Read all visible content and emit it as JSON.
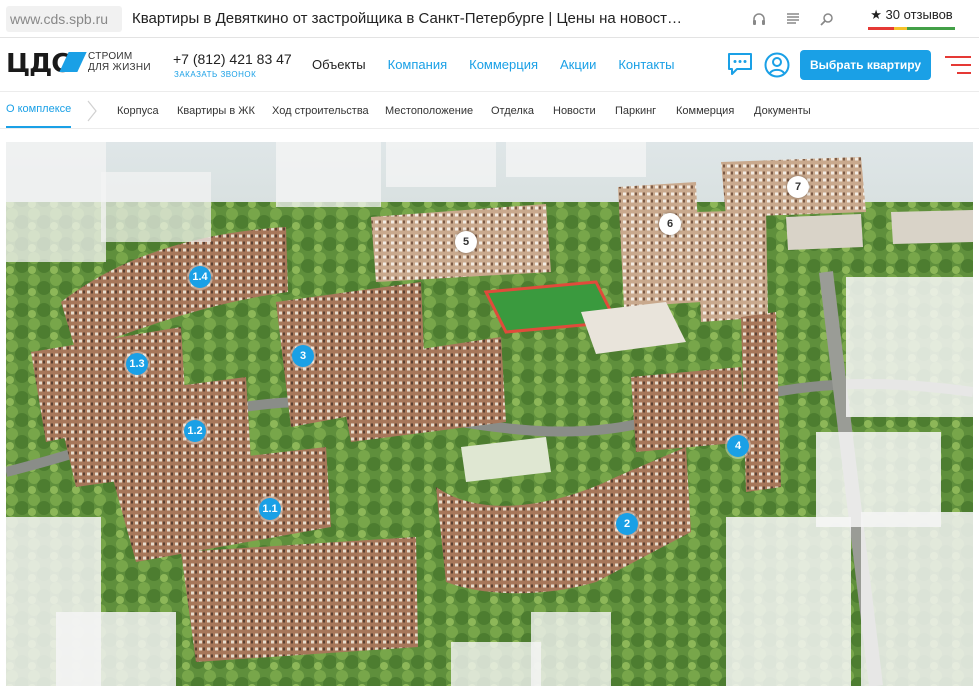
{
  "browser": {
    "url": "www.cds.spb.ru",
    "title": "Квартиры в Девяткино от застройщика в Санкт-Петербурге | Цены на новост…",
    "reviews": "★ 30 отзывов",
    "icons": [
      "headphones-icon",
      "reader-icon",
      "search-icon"
    ]
  },
  "header": {
    "logo_text": "ЦДС",
    "logo_tagline_1": "СТРОИМ",
    "logo_tagline_2": "ДЛЯ ЖИЗНИ",
    "phone": "+7 (812) 421 83 47",
    "callback": "ЗАКАЗАТЬ ЗВОНОК",
    "nav": [
      "Объекты",
      "Компания",
      "Коммерция",
      "Акции",
      "Контакты"
    ],
    "cta": "Выбрать квартиру",
    "colors": {
      "accent": "#1aa0e6",
      "burger": "#e53935"
    }
  },
  "subnav": {
    "items": [
      "О комплексе",
      "Корпуса",
      "Квартиры в ЖК",
      "Ход строительства",
      "Местоположение",
      "Отделка",
      "Новости",
      "Паркинг",
      "Коммерция",
      "Документы"
    ],
    "active_index": 0
  },
  "hero": {
    "markers": [
      {
        "label": "1.4",
        "style": "blue"
      },
      {
        "label": "1.3",
        "style": "blue"
      },
      {
        "label": "1.2",
        "style": "blue"
      },
      {
        "label": "1.1",
        "style": "blue"
      },
      {
        "label": "3",
        "style": "blue"
      },
      {
        "label": "2",
        "style": "blue"
      },
      {
        "label": "4",
        "style": "blue"
      },
      {
        "label": "5",
        "style": "white"
      },
      {
        "label": "6",
        "style": "white"
      },
      {
        "label": "7",
        "style": "white"
      }
    ]
  }
}
